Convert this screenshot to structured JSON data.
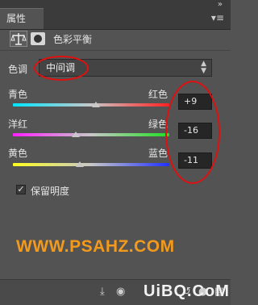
{
  "panel": {
    "tab_label": "属性",
    "menu_icon": "menu-lines-icon",
    "collapse_icon": "double-arrow-icon"
  },
  "header": {
    "title": "色彩平衡",
    "adjustment_icon": "balance-scale-icon",
    "mask_icon": "layer-mask-icon"
  },
  "tone": {
    "label": "色调",
    "value": "中间调"
  },
  "sliders": [
    {
      "left": "青色",
      "right": "红色",
      "value": "+9",
      "level": 9
    },
    {
      "left": "洋红",
      "right": "绿色",
      "value": "-16",
      "level": -16
    },
    {
      "left": "黄色",
      "right": "蓝色",
      "value": "-11",
      "level": -11
    }
  ],
  "preserve_luminosity": {
    "label": "保留明度",
    "checked": true
  },
  "watermark": "WWW.PSAHZ.COM",
  "logo": "UiBQ.CoM",
  "colors": {
    "highlight_ring": "#e01010",
    "watermark": "#f39a1c"
  }
}
